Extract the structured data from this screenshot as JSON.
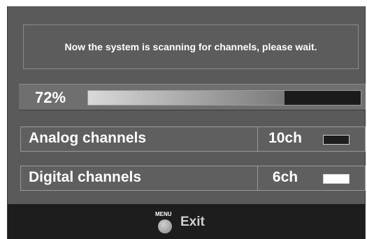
{
  "scan": {
    "message": "Now the system is scanning for channels, please wait.",
    "progress_label": "72%",
    "progress_fraction": 0.72
  },
  "channels": [
    {
      "label": "Analog channels",
      "count": "10ch",
      "swatch_color": "#1e1e1e"
    },
    {
      "label": "Digital channels",
      "count": "6ch",
      "swatch_color": "#ffffff"
    }
  ],
  "footer": {
    "menu_key": "MENU",
    "exit_label": "Exit"
  },
  "colors": {
    "background": "#5a5a5a",
    "footer": "#1d1d1d",
    "progress_track": "#1b1b1b"
  }
}
